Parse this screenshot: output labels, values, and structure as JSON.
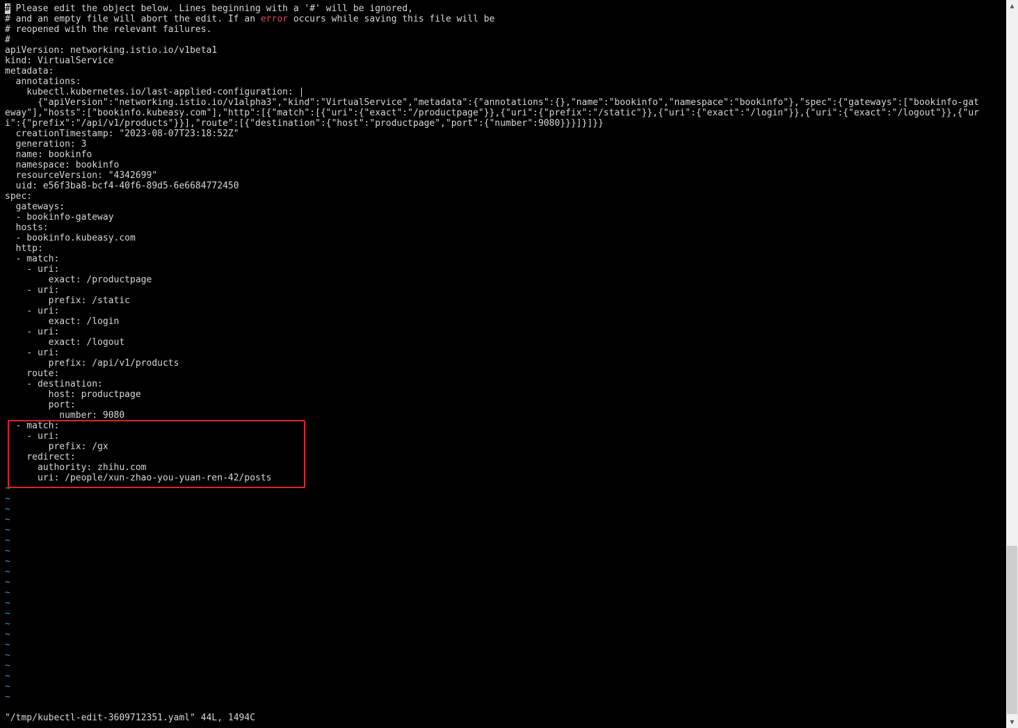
{
  "editor": {
    "header_lines": [
      {
        "first_char": "#",
        "rest": " Please edit the object below. Lines beginning with a '#' will be ignored,"
      },
      {
        "before": "# and an empty file will abort the edit. If an ",
        "error_word": "error",
        "after": " occurs while saving this file will be"
      },
      {
        "text": "# reopened with the relevant failures."
      },
      {
        "text": "#"
      }
    ],
    "yaml_lines": [
      "apiVersion: networking.istio.io/v1beta1",
      "kind: VirtualService",
      "metadata:",
      "  annotations:",
      "    kubectl.kubernetes.io/last-applied-configuration: |",
      "      {\"apiVersion\":\"networking.istio.io/v1alpha3\",\"kind\":\"VirtualService\",\"metadata\":{\"annotations\":{},\"name\":\"bookinfo\",\"namespace\":\"bookinfo\"},\"spec\":{\"gateways\":[\"bookinfo-gat",
      "eway\"],\"hosts\":[\"bookinfo.kubeasy.com\"],\"http\":[{\"match\":[{\"uri\":{\"exact\":\"/productpage\"}},{\"uri\":{\"prefix\":\"/static\"}},{\"uri\":{\"exact\":\"/login\"}},{\"uri\":{\"exact\":\"/logout\"}},{\"ur",
      "i\":{\"prefix\":\"/api/v1/products\"}}],\"route\":[{\"destination\":{\"host\":\"productpage\",\"port\":{\"number\":9080}}}]}]}}",
      "  creationTimestamp: \"2023-08-07T23:18:52Z\"",
      "  generation: 3",
      "  name: bookinfo",
      "  namespace: bookinfo",
      "  resourceVersion: \"4342699\"",
      "  uid: e56f3ba8-bcf4-40f6-89d5-6e6684772450",
      "spec:",
      "  gateways:",
      "  - bookinfo-gateway",
      "  hosts:",
      "  - bookinfo.kubeasy.com",
      "  http:",
      "  - match:",
      "    - uri:",
      "        exact: /productpage",
      "    - uri:",
      "        prefix: /static",
      "    - uri:",
      "        exact: /login",
      "    - uri:",
      "        exact: /logout",
      "    - uri:",
      "        prefix: /api/v1/products",
      "    route:",
      "    - destination:",
      "        host: productpage",
      "        port:",
      "          number: 9080",
      "  - match:",
      "    - uri:",
      "        prefix: /gx",
      "    redirect:",
      "      authority: zhihu.com",
      "      uri: /people/xun-zhao-you-yuan-ren-42/posts"
    ],
    "empty_line_marker": "~",
    "empty_line_count": 21,
    "status_line": "\"/tmp/kubectl-edit-3609712351.yaml\" 44L, 1494C"
  },
  "colors": {
    "background": "#000000",
    "foreground": "#d8d8d8",
    "error_word": "#e0475a",
    "tilde": "#2aa7c7",
    "highlight_box": "#e0232b"
  },
  "scrollbar": {
    "up_arrow_icon": "▲",
    "down_arrow_icon": "▼",
    "thumb_position_fraction": 0.76
  }
}
